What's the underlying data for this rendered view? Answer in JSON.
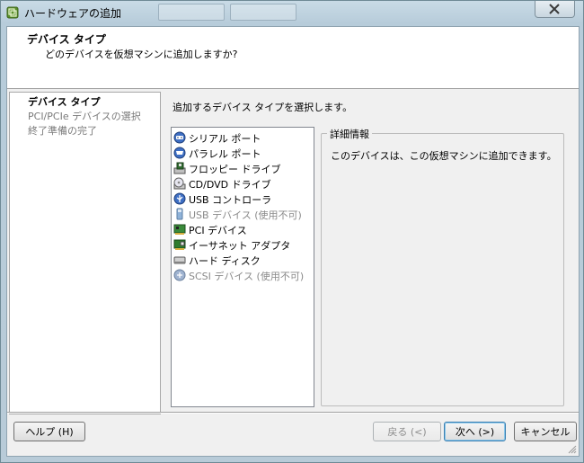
{
  "window": {
    "title": "ハードウェアの追加",
    "app_icon": "vsphere-icon",
    "close_icon": "close-icon"
  },
  "header": {
    "title": "デバイス タイプ",
    "subtitle": "どのデバイスを仮想マシンに追加しますか?"
  },
  "steps": [
    {
      "label": "デバイス タイプ",
      "state": "current"
    },
    {
      "label": "PCI/PCIe デバイスの選択",
      "state": "pending"
    },
    {
      "label": "終了準備の完了",
      "state": "pending"
    }
  ],
  "main": {
    "prompt": "追加するデバイス タイプを選択します。",
    "devices": [
      {
        "label": "シリアル ポート",
        "icon": "serial-port-icon",
        "enabled": true
      },
      {
        "label": "パラレル ポート",
        "icon": "parallel-port-icon",
        "enabled": true
      },
      {
        "label": "フロッピー ドライブ",
        "icon": "floppy-drive-icon",
        "enabled": true
      },
      {
        "label": "CD/DVD ドライブ",
        "icon": "cd-dvd-drive-icon",
        "enabled": true
      },
      {
        "label": "USB コントローラ",
        "icon": "usb-controller-icon",
        "enabled": true
      },
      {
        "label": "USB デバイス (使用不可)",
        "icon": "usb-device-icon",
        "enabled": false
      },
      {
        "label": "PCI デバイス",
        "icon": "pci-device-icon",
        "enabled": true
      },
      {
        "label": "イーサネット アダプタ",
        "icon": "ethernet-adapter-icon",
        "enabled": true
      },
      {
        "label": "ハード ディスク",
        "icon": "hard-disk-icon",
        "enabled": true
      },
      {
        "label": "SCSI デバイス (使用不可)",
        "icon": "scsi-device-icon",
        "enabled": false
      }
    ],
    "details": {
      "legend": "詳細情報",
      "text": "このデバイスは、この仮想マシンに追加できます。"
    }
  },
  "footer": {
    "help_label": "ヘルプ (H)",
    "back_label": "戻る (<)",
    "next_label": "次へ (>)",
    "cancel_label": "キャンセル"
  },
  "colors": {
    "title_bar": "#b9cedb",
    "disabled_text": "#8a8a8a",
    "default_button_border": "#3c7fb1"
  }
}
